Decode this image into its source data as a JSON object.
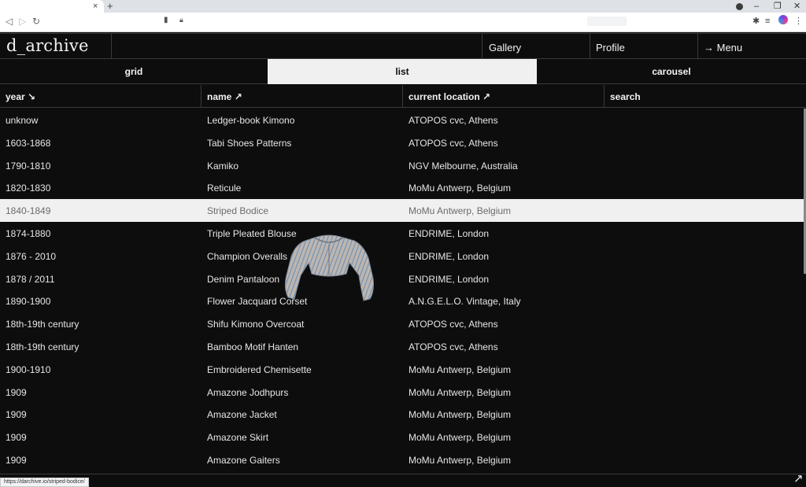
{
  "browser": {
    "tab_close": "×",
    "new_tab": "+",
    "minimize": "–",
    "restore": "❐",
    "close": "✕",
    "back": "◁",
    "forward": "▷",
    "reload": "↻",
    "menu_dots": "⋮",
    "status_url": "https://darchive.io/striped-bodice/"
  },
  "header": {
    "logo": "d_archive",
    "nav": [
      {
        "label": "Gallery"
      },
      {
        "label": "Profile"
      },
      {
        "label": "Menu",
        "icon": "→"
      }
    ]
  },
  "view_tabs": [
    {
      "label": "grid"
    },
    {
      "label": "list",
      "active": true
    },
    {
      "label": "carousel"
    }
  ],
  "columns": [
    {
      "label": "year",
      "icon": "↘"
    },
    {
      "label": "name",
      "icon": "↗"
    },
    {
      "label": "current location",
      "icon": "↗"
    },
    {
      "label": "search",
      "icon": ""
    }
  ],
  "rows": [
    {
      "year": "unknow",
      "name": "Ledger-book Kimono",
      "location": "ATOPOS cvc, Athens"
    },
    {
      "year": "1603-1868",
      "name": "Tabi Shoes Patterns",
      "location": "ATOPOS cvc, Athens"
    },
    {
      "year": "1790-1810",
      "name": "Kamiko",
      "location": "NGV Melbourne, Australia"
    },
    {
      "year": "1820-1830",
      "name": "Reticule",
      "location": "MoMu Antwerp, Belgium"
    },
    {
      "year": "1840-1849",
      "name": "Striped Bodice",
      "location": "MoMu Antwerp, Belgium",
      "highlighted": true
    },
    {
      "year": "1874-1880",
      "name": "Triple Pleated Blouse",
      "location": "ENDRIME, London"
    },
    {
      "year": "1876 - 2010",
      "name": "Champion Overalls",
      "location": "ENDRIME, London"
    },
    {
      "year": "1878 / 2011",
      "name": "Denim Pantaloon",
      "location": "ENDRIME, London"
    },
    {
      "year": "1890-1900",
      "name": "Flower Jacquard Corset",
      "location": "A.N.G.E.L.O. Vintage, Italy"
    },
    {
      "year": "18th-19th century",
      "name": "Shifu Kimono Overcoat",
      "location": "ATOPOS cvc, Athens"
    },
    {
      "year": "18th-19th century",
      "name": "Bamboo Motif Hanten",
      "location": "ATOPOS cvc, Athens"
    },
    {
      "year": "1900-1910",
      "name": "Embroidered Chemisette",
      "location": "MoMu Antwerp, Belgium"
    },
    {
      "year": "1909",
      "name": "Amazone Jodhpurs",
      "location": "MoMu Antwerp, Belgium"
    },
    {
      "year": "1909",
      "name": "Amazone Jacket",
      "location": "MoMu Antwerp, Belgium"
    },
    {
      "year": "1909",
      "name": "Amazone Skirt",
      "location": "MoMu Antwerp, Belgium"
    },
    {
      "year": "1909",
      "name": "Amazone Gaiters",
      "location": "MoMu Antwerp, Belgium"
    }
  ],
  "corner_icon": "↗",
  "colors": {
    "background": "#0d0d0d",
    "text": "#f2f2f2",
    "highlight_row": "#f0f0f0",
    "divider": "#3a3a3a"
  }
}
